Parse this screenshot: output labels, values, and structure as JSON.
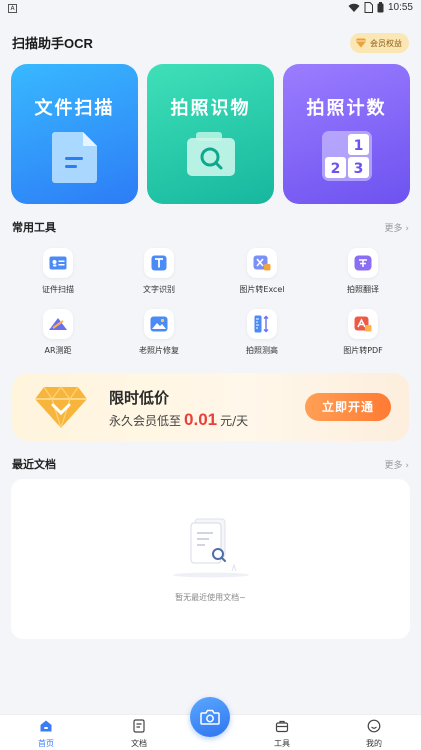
{
  "status_bar": {
    "app_glyph": "A",
    "time": "10:55",
    "icons": [
      "wifi-icon",
      "sim-icon",
      "battery-icon"
    ]
  },
  "header": {
    "title": "扫描助手OCR",
    "vip_label": "会员权益"
  },
  "big_cards": [
    {
      "label": "文件扫描",
      "icon": "document-icon"
    },
    {
      "label": "拍照识物",
      "icon": "camera-search-icon"
    },
    {
      "label": "拍照计数",
      "icon": "number-grid-icon"
    }
  ],
  "number_grid": [
    "1",
    "2",
    "3"
  ],
  "tools_section": {
    "title": "常用工具",
    "more": "更多 ›"
  },
  "tools": [
    {
      "label": "证件扫描",
      "icon": "id-card-icon"
    },
    {
      "label": "文字识别",
      "icon": "text-icon"
    },
    {
      "label": "图片转Excel",
      "icon": "excel-icon"
    },
    {
      "label": "拍照翻译",
      "icon": "translate-icon"
    },
    {
      "label": "AR测距",
      "icon": "ar-measure-icon"
    },
    {
      "label": "老照片修复",
      "icon": "photo-restore-icon"
    },
    {
      "label": "拍照测高",
      "icon": "height-measure-icon"
    },
    {
      "label": "图片转PDF",
      "icon": "pdf-icon"
    }
  ],
  "promo": {
    "title": "限时低价",
    "sub_prefix": "永久会员低至",
    "price": "0.01",
    "sub_suffix": "元/天",
    "button": "立即开通"
  },
  "recent_section": {
    "title": "最近文档",
    "more": "更多 ›"
  },
  "recent_empty": "暂无最近使用文档~",
  "bottom_nav": [
    {
      "label": "首页",
      "icon": "home-icon",
      "active": true
    },
    {
      "label": "文档",
      "icon": "document-list-icon",
      "active": false
    },
    {
      "label": "工具",
      "icon": "toolbox-icon",
      "active": false
    },
    {
      "label": "我的",
      "icon": "profile-icon",
      "active": false
    }
  ],
  "colors": {
    "accent": "#3a7cf6",
    "scan_card": "#2d7cf6",
    "identify_card": "#16b79e",
    "count_card": "#6d52f0",
    "price": "#e8403a",
    "promo_button": "#ff7a33"
  }
}
